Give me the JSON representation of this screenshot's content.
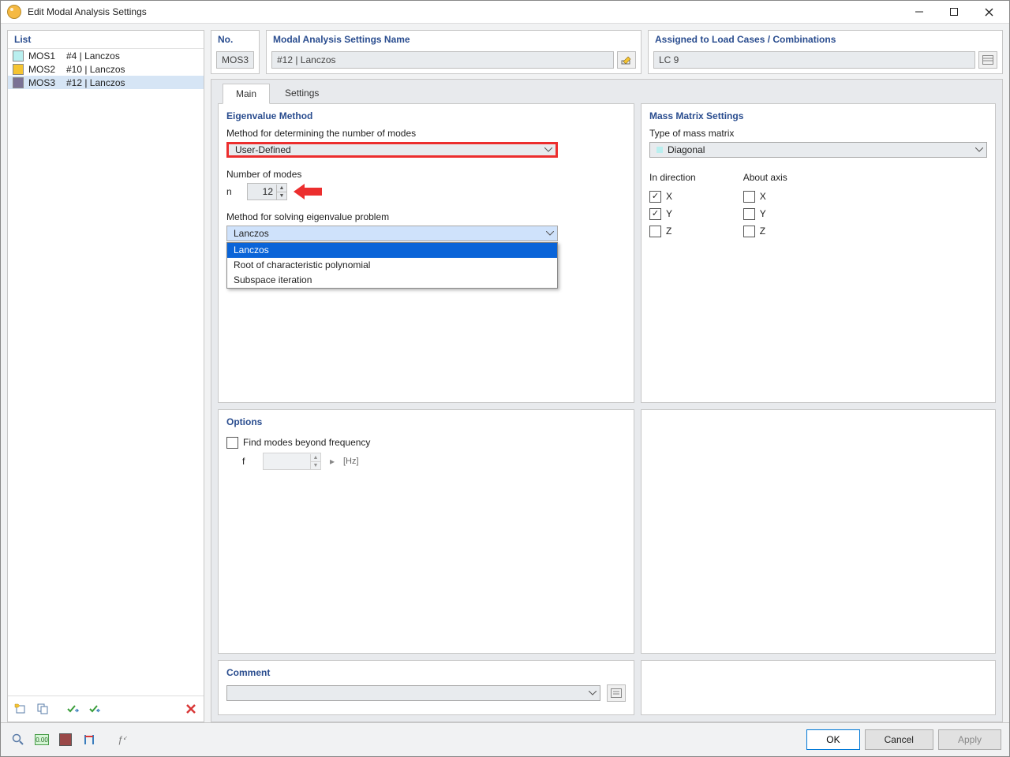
{
  "window": {
    "title": "Edit Modal Analysis Settings"
  },
  "list": {
    "header": "List",
    "items": [
      {
        "code": "MOS1",
        "label": "#4 | Lanczos",
        "color": "#b9efef"
      },
      {
        "code": "MOS2",
        "label": "#10 | Lanczos",
        "color": "#f5c431"
      },
      {
        "code": "MOS3",
        "label": "#12 | Lanczos",
        "color": "#7a7295",
        "selected": true
      }
    ]
  },
  "header_fields": {
    "no_label": "No.",
    "no_value": "MOS3",
    "name_label": "Modal Analysis Settings Name",
    "name_value": "#12 | Lanczos",
    "assigned_label": "Assigned to Load Cases / Combinations",
    "assigned_value": "LC 9"
  },
  "tabs": {
    "main": "Main",
    "settings": "Settings"
  },
  "eigen": {
    "title": "Eigenvalue Method",
    "method_det_label": "Method for determining the number of modes",
    "method_det_value": "User-Defined",
    "num_modes_label": "Number of modes",
    "n_symbol": "n",
    "n_value": "12",
    "solve_label": "Method for solving eigenvalue problem",
    "solve_value": "Lanczos",
    "solve_options": [
      "Lanczos",
      "Root of characteristic polynomial",
      "Subspace iteration"
    ]
  },
  "options": {
    "title": "Options",
    "find_label": "Find modes beyond frequency",
    "f_symbol": "f",
    "hz": "[Hz]"
  },
  "mass": {
    "title": "Mass Matrix Settings",
    "type_label": "Type of mass matrix",
    "type_value": "Diagonal",
    "direction_label": "In direction",
    "axis_label": "About axis",
    "X": "X",
    "Y": "Y",
    "Z": "Z"
  },
  "comment": {
    "title": "Comment"
  },
  "buttons": {
    "ok": "OK",
    "cancel": "Cancel",
    "apply": "Apply"
  }
}
